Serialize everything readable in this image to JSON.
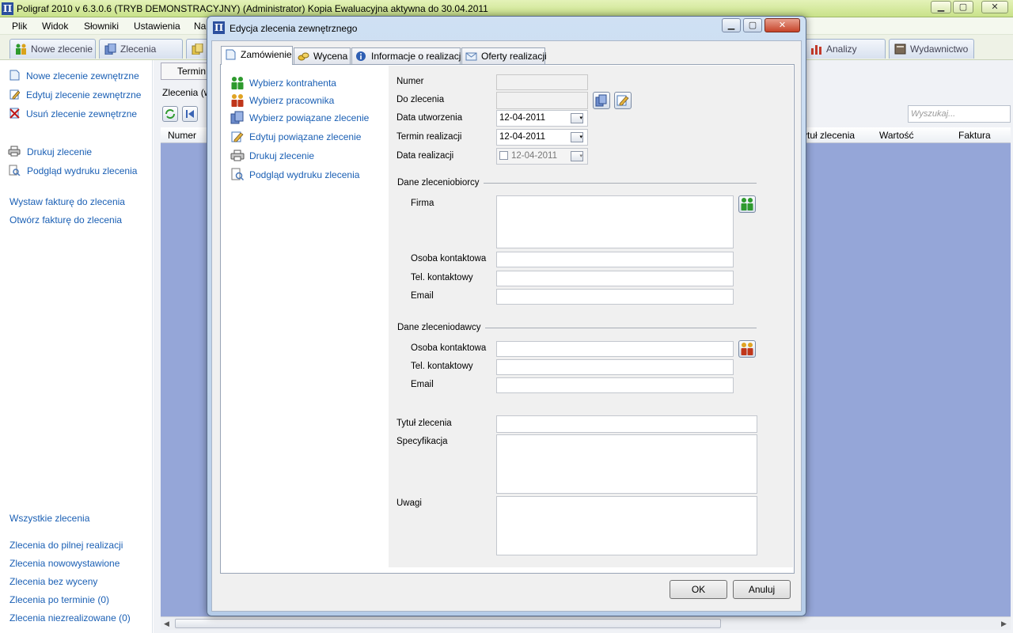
{
  "app": {
    "logo_glyph": "Π",
    "title": "Poligraf 2010 v 6.3.0.6 (TRYB DEMONSTRACYJNY) (Administrator) Kopia Ewaluacyjna aktywna do 30.04.2011",
    "minimize": "▁",
    "maximize": "▢",
    "close": "✕"
  },
  "menu": [
    "Plik",
    "Widok",
    "Słowniki",
    "Ustawienia",
    "Na"
  ],
  "main_tabs": {
    "new_order": "Nowe zlecenie",
    "orders": "Zlecenia",
    "analyses": "Analizy",
    "publishing": "Wydawnictwo"
  },
  "sidebar": {
    "actions": [
      {
        "label": "Nowe zlecenie zewnętrzne",
        "icon": "new-document-icon"
      },
      {
        "label": "Edytuj zlecenie zewnętrzne",
        "icon": "edit-icon"
      },
      {
        "label": "Usuń zlecenie zewnętrzne",
        "icon": "delete-icon"
      },
      {
        "label": "Drukuj zlecenie",
        "icon": "printer-icon"
      },
      {
        "label": "Podgląd wydruku zlecenia",
        "icon": "print-preview-icon"
      }
    ],
    "invoice_links": [
      "Wystaw fakturę do zlecenia",
      "Otwórz fakturę do zlecenia"
    ],
    "filters": [
      "Wszystkie zlecenia",
      "Zlecenia do pilnej realizacji",
      "Zlecenia nowowystawione",
      "Zlecenia bez wyceny",
      "Zlecenia po terminie (0)",
      "Zlecenia niezrealizowane (0)"
    ]
  },
  "background": {
    "tab_label": "Termin",
    "orders_label": "Zlecenia (w",
    "search_placeholder": "Wyszukaj...",
    "columns": [
      "Numer",
      "ytuł zlecenia",
      "Wartość",
      "Faktura"
    ]
  },
  "dialog": {
    "logo_glyph": "Π",
    "title": "Edycja zlecenia zewnętrznego",
    "tabs": [
      {
        "label": "Zamówienie",
        "icon": "document-icon"
      },
      {
        "label": "Wycena",
        "icon": "coins-icon"
      },
      {
        "label": "Informacje o realizacji",
        "icon": "info-icon"
      },
      {
        "label": "Oferty realizacji",
        "icon": "envelope-icon"
      }
    ],
    "actions": [
      {
        "label": "Wybierz kontrahenta",
        "icon": "contractor-icon"
      },
      {
        "label": "Wybierz pracownika",
        "icon": "employee-icon"
      },
      {
        "label": "Wybierz powiązane zlecenie",
        "icon": "copy-icon"
      },
      {
        "label": "Edytuj powiązane zlecenie",
        "icon": "edit-icon"
      },
      {
        "label": "Drukuj zlecenie",
        "icon": "printer-icon"
      },
      {
        "label": "Podgląd wydruku zlecenia",
        "icon": "print-preview-icon"
      }
    ],
    "form": {
      "numer_label": "Numer",
      "numer_value": "",
      "do_zlecenia_label": "Do zlecenia",
      "do_zlecenia_value": "",
      "data_utworzenia_label": "Data utworzenia",
      "data_utworzenia_value": "12-04-2011",
      "termin_label": "Termin realizacji",
      "termin_value": "12-04-2011",
      "data_realizacji_label": "Data realizacji",
      "data_realizacji_value": "12-04-2011",
      "zleceniobiorca_section": "Dane zleceniobiorcy",
      "firma_label": "Firma",
      "firma_value": "",
      "osoba1_label": "Osoba kontaktowa",
      "osoba1_value": "",
      "tel1_label": "Tel. kontaktowy",
      "tel1_value": "",
      "email1_label": "Email",
      "email1_value": "",
      "zleceniodawca_section": "Dane zleceniodawcy",
      "osoba2_label": "Osoba kontaktowa",
      "osoba2_value": "",
      "tel2_label": "Tel. kontaktowy",
      "tel2_value": "",
      "email2_label": "Email",
      "email2_value": "",
      "tytul_label": "Tytuł zlecenia",
      "tytul_value": "",
      "specyfikacja_label": "Specyfikacja",
      "specyfikacja_value": "",
      "uwagi_label": "Uwagi",
      "uwagi_value": ""
    },
    "ok": "OK",
    "cancel": "Anuluj"
  },
  "colors": {
    "link": "#1a5fb4",
    "grid_background": "#95a6d8",
    "titlebar": "#c9e28a"
  }
}
